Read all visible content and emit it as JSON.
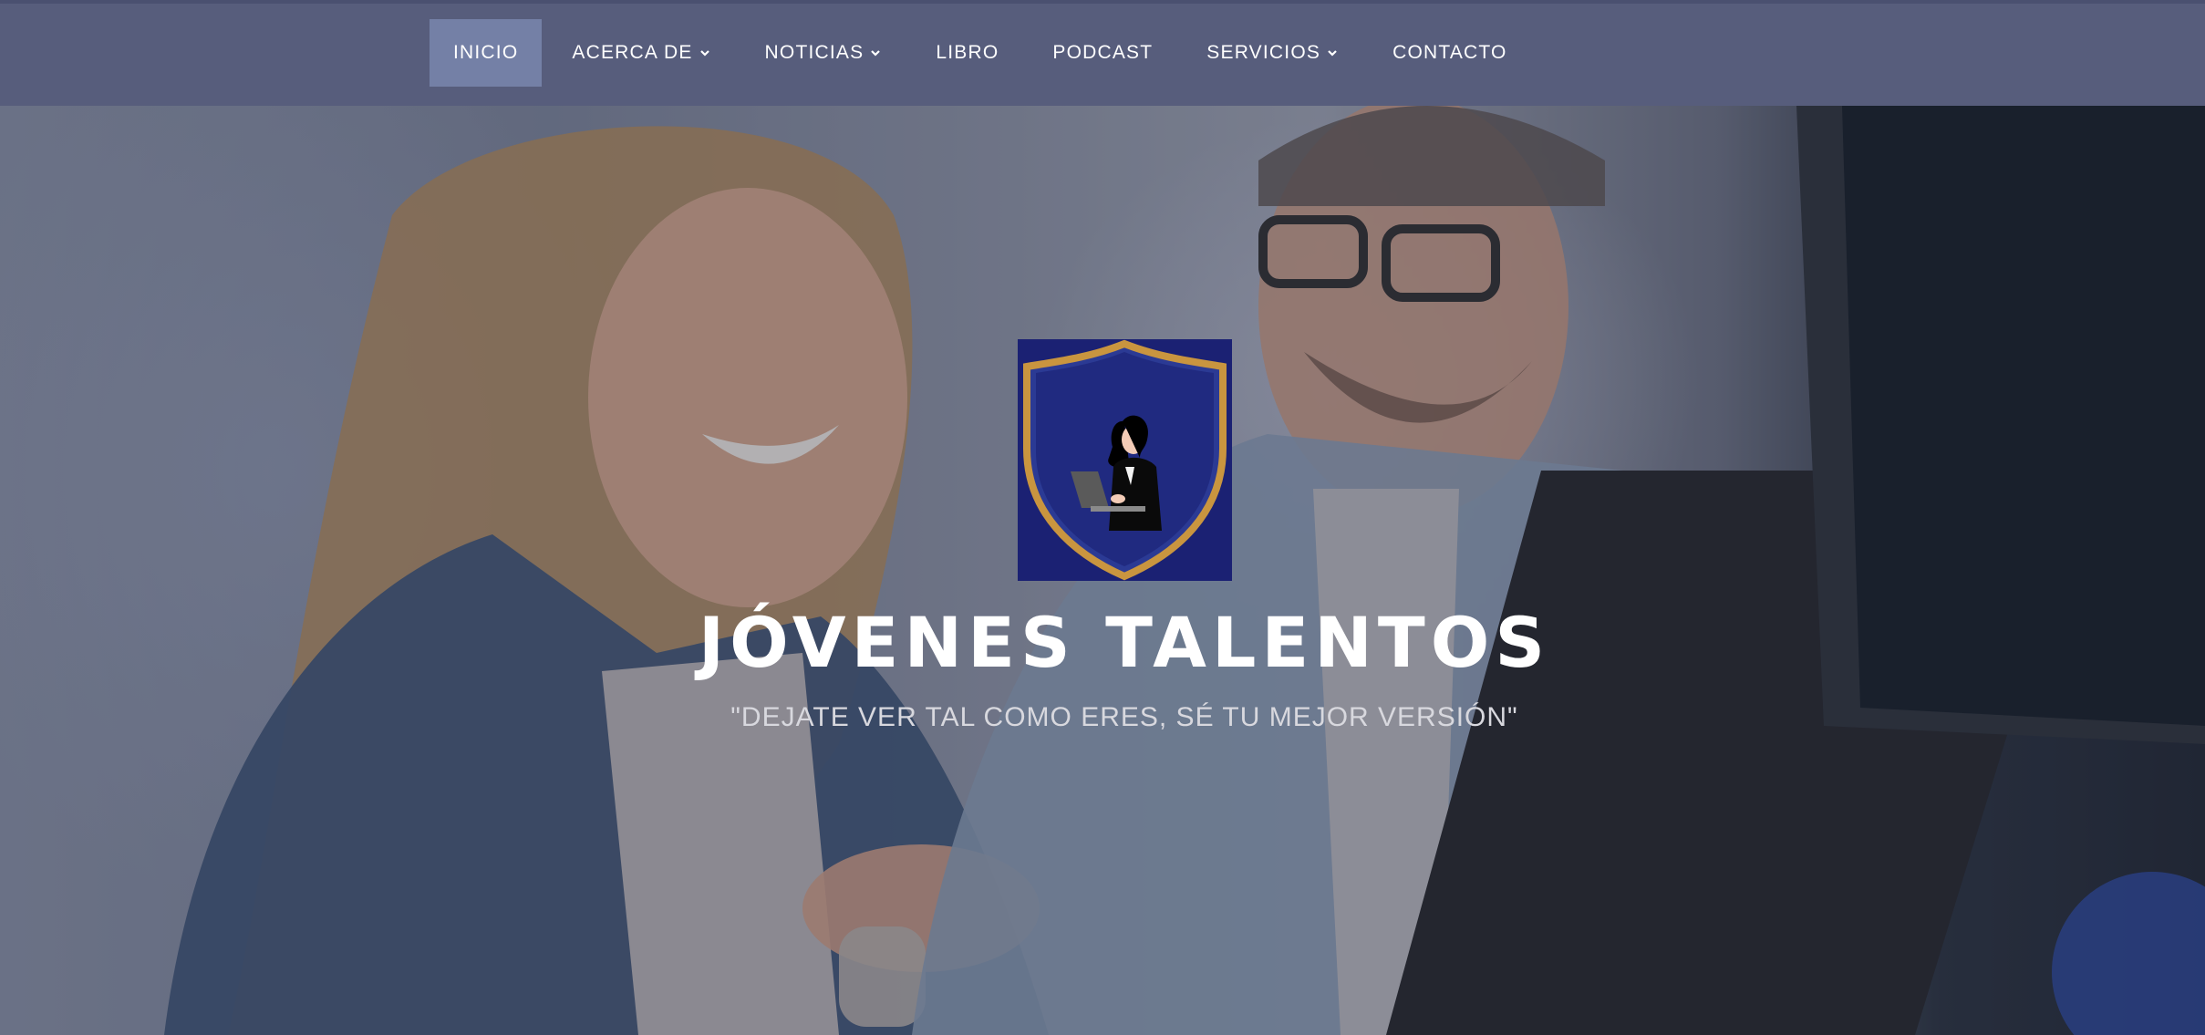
{
  "nav": {
    "items": [
      {
        "label": "INICIO",
        "active": true,
        "has_dropdown": false
      },
      {
        "label": "ACERCA DE",
        "active": false,
        "has_dropdown": true
      },
      {
        "label": "NOTICIAS",
        "active": false,
        "has_dropdown": true
      },
      {
        "label": "LIBRO",
        "active": false,
        "has_dropdown": false
      },
      {
        "label": "PODCAST",
        "active": false,
        "has_dropdown": false
      },
      {
        "label": "SERVICIOS",
        "active": false,
        "has_dropdown": true
      },
      {
        "label": "CONTACTO",
        "active": false,
        "has_dropdown": false
      }
    ]
  },
  "hero": {
    "title": "JÓVENES TALENTOS",
    "subtitle": "\"DEJATE VER TAL COMO ERES, SÉ TU MEJOR VERSIÓN\"",
    "background_image": "two-people-laughing-at-computer",
    "logo_icon": "shield-woman-laptop-icon"
  },
  "colors": {
    "nav_background": "#575d7c",
    "nav_active": "#7480a6",
    "logo_background": "#1b2173",
    "logo_shield_border": "#c9953f"
  }
}
